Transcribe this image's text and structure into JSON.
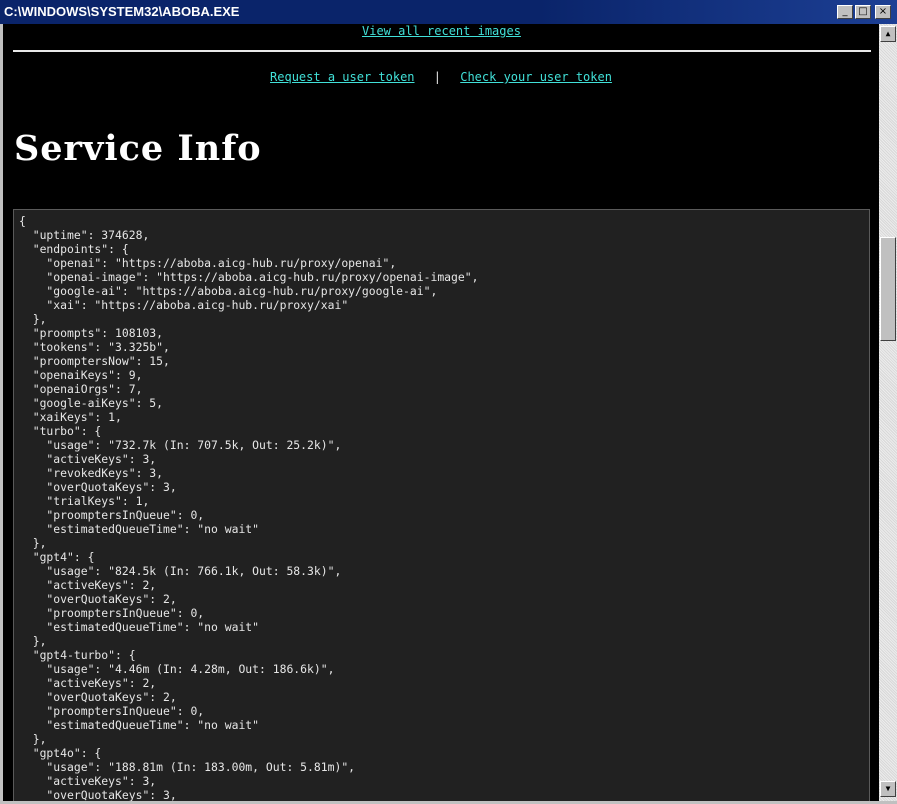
{
  "window": {
    "title": "C:\\WINDOWS\\SYSTEM32\\ABOBA.EXE",
    "buttons": {
      "minimize": "_",
      "maximize": "□",
      "close": "×"
    }
  },
  "nav": {
    "recent_images_link": "View all recent images",
    "request_token_link": "Request a user token",
    "separator": "|",
    "check_token_link": "Check your user token"
  },
  "page": {
    "heading": "Service Info"
  },
  "service_info_json": "{\n  \"uptime\": 374628,\n  \"endpoints\": {\n    \"openai\": \"https://aboba.aicg-hub.ru/proxy/openai\",\n    \"openai-image\": \"https://aboba.aicg-hub.ru/proxy/openai-image\",\n    \"google-ai\": \"https://aboba.aicg-hub.ru/proxy/google-ai\",\n    \"xai\": \"https://aboba.aicg-hub.ru/proxy/xai\"\n  },\n  \"proompts\": 108103,\n  \"tookens\": \"3.325b\",\n  \"proomptersNow\": 15,\n  \"openaiKeys\": 9,\n  \"openaiOrgs\": 7,\n  \"google-aiKeys\": 5,\n  \"xaiKeys\": 1,\n  \"turbo\": {\n    \"usage\": \"732.7k (In: 707.5k, Out: 25.2k)\",\n    \"activeKeys\": 3,\n    \"revokedKeys\": 3,\n    \"overQuotaKeys\": 3,\n    \"trialKeys\": 1,\n    \"proomptersInQueue\": 0,\n    \"estimatedQueueTime\": \"no wait\"\n  },\n  \"gpt4\": {\n    \"usage\": \"824.5k (In: 766.1k, Out: 58.3k)\",\n    \"activeKeys\": 2,\n    \"overQuotaKeys\": 2,\n    \"proomptersInQueue\": 0,\n    \"estimatedQueueTime\": \"no wait\"\n  },\n  \"gpt4-turbo\": {\n    \"usage\": \"4.46m (In: 4.28m, Out: 186.6k)\",\n    \"activeKeys\": 2,\n    \"overQuotaKeys\": 2,\n    \"proomptersInQueue\": 0,\n    \"estimatedQueueTime\": \"no wait\"\n  },\n  \"gpt4o\": {\n    \"usage\": \"188.81m (In: 183.00m, Out: 5.81m)\",\n    \"activeKeys\": 3,\n    \"overQuotaKeys\": 3,",
  "scrollbar": {
    "position_fraction": 0.28
  }
}
